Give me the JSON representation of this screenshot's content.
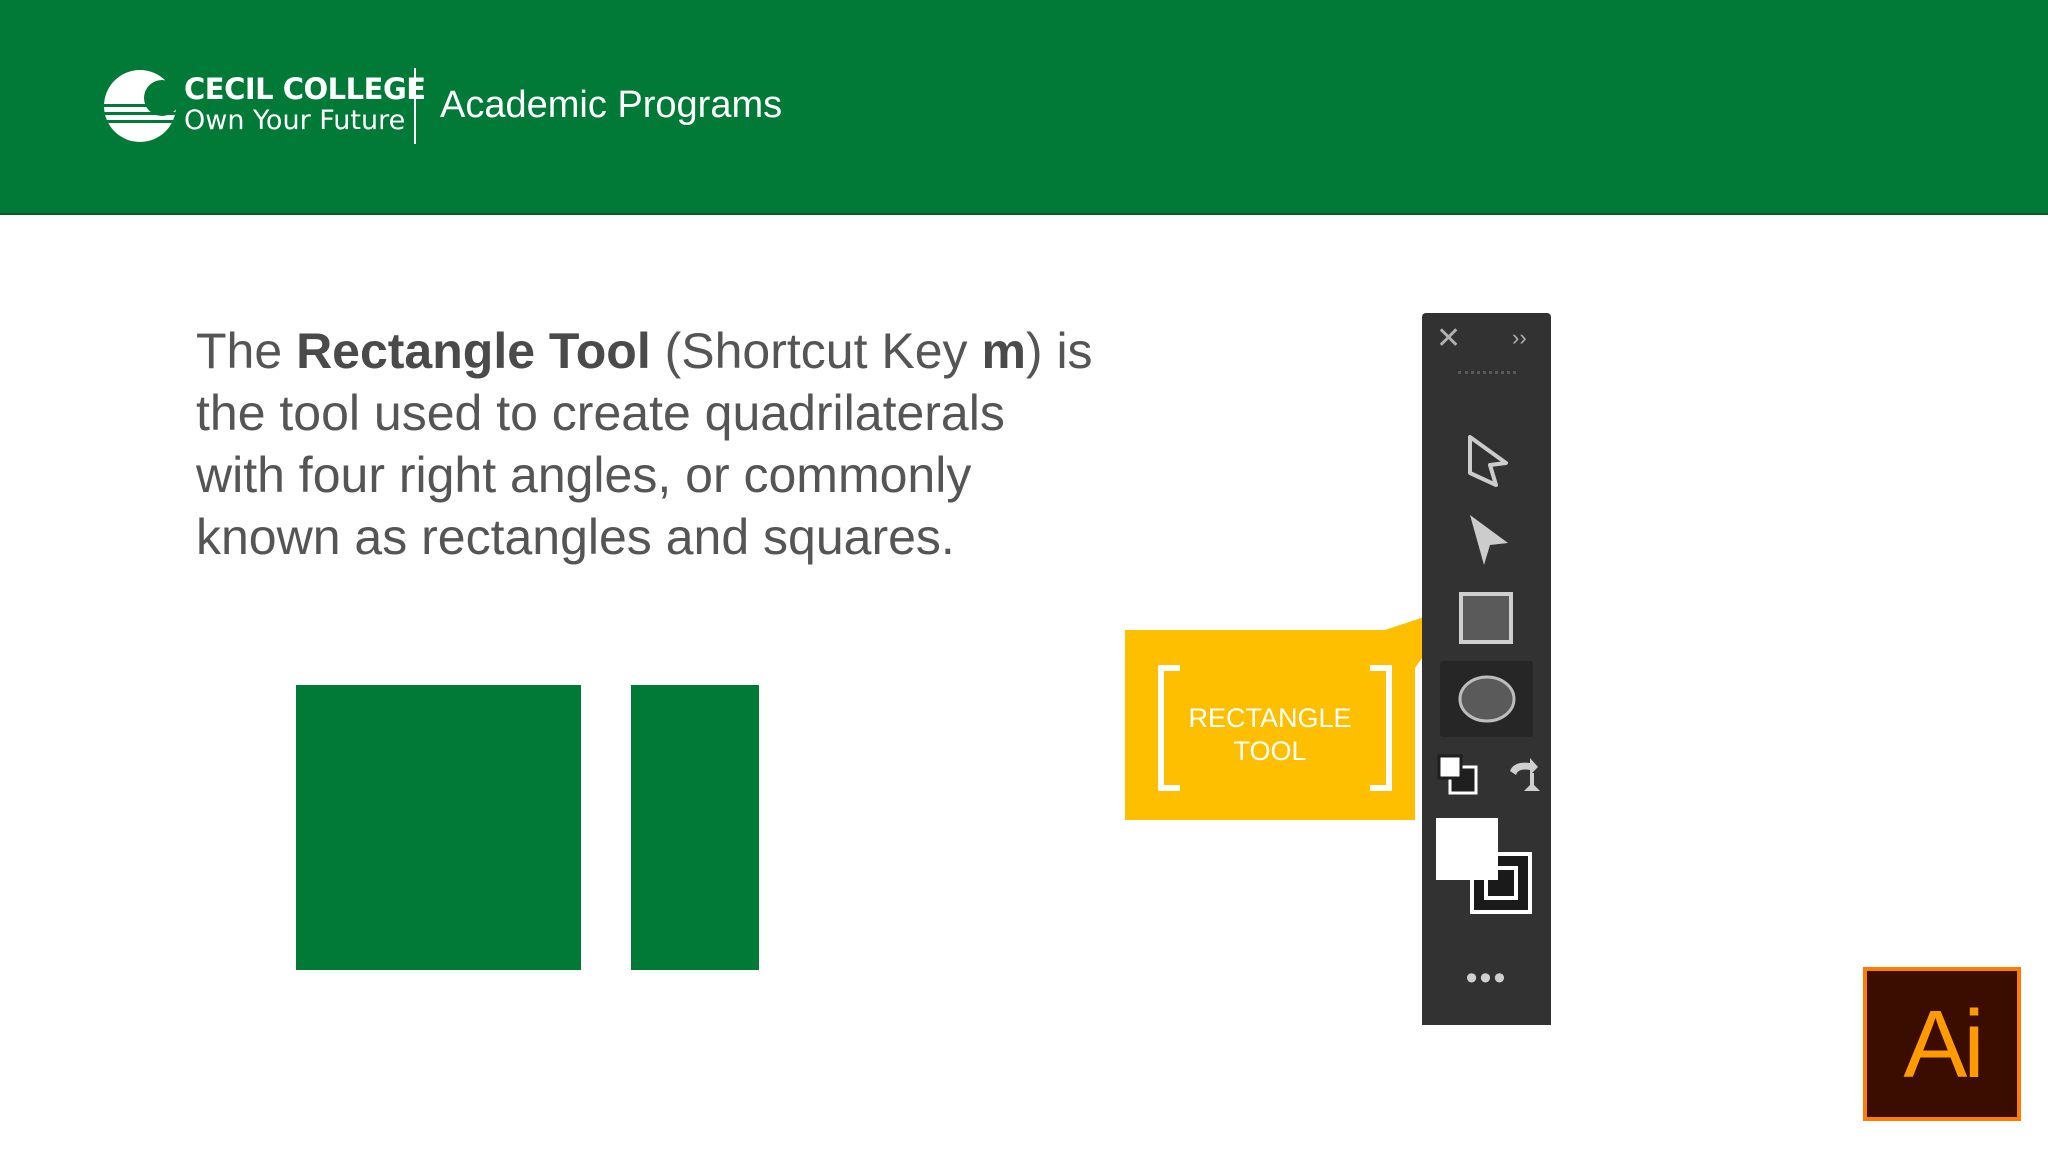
{
  "header": {
    "logo_line1": "CECIL COLLEGE",
    "logo_line2": "Own Your Future",
    "title": "Academic Programs",
    "background": "#007a36"
  },
  "slide": {
    "text_part1": "The ",
    "text_bold1": "Rectangle Tool",
    "text_part2": " (Shortcut Key ",
    "text_bold2": "m",
    "text_part3": ") is the tool used to create quadrilaterals with four right angles, or commonly known as rectangles and squares."
  },
  "callout": {
    "line1": "RECTANGLE",
    "line2": "TOOL",
    "color": "#fdbf00"
  },
  "toolbar": {
    "close_icon": "close-icon",
    "collapse_icon": "double-chevron-icon",
    "more_label": "•••",
    "tools": [
      "selection-tool",
      "direct-selection-tool",
      "rectangle-tool",
      "ellipse-tool",
      "default-fill-stroke",
      "swap-fill-stroke",
      "fill-color",
      "stroke-color"
    ]
  },
  "app_logo": {
    "label": "Ai",
    "border_color": "#ff7c00",
    "background": "#3a0d00"
  }
}
